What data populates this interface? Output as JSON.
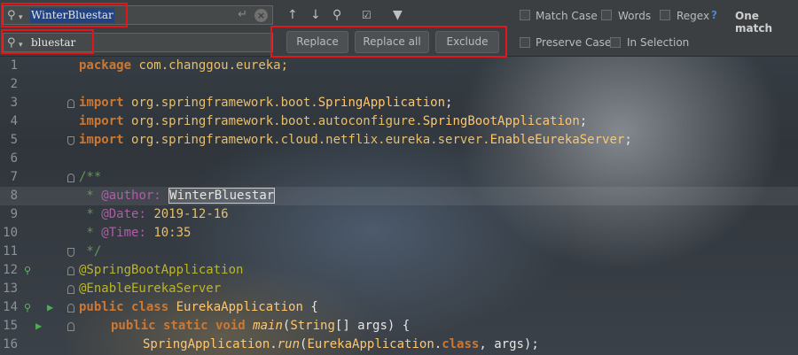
{
  "find": {
    "query": "WinterBluestar",
    "replacement": "bluestar"
  },
  "options": {
    "match_case": "Match Case",
    "words": "Words",
    "regex": "Regex",
    "help": "?",
    "match_count": "One match",
    "preserve_case": "Preserve Case",
    "in_selection": "In Selection"
  },
  "buttons": {
    "replace": "Replace",
    "replace_all": "Replace all",
    "exclude": "Exclude"
  },
  "editor": {
    "line_numbers": [
      "1",
      "2",
      "3",
      "4",
      "5",
      "6",
      "7",
      "8",
      "9",
      "10",
      "11",
      "12",
      "13",
      "14",
      "15",
      "16"
    ],
    "line1": {
      "kw": "package",
      "rest": "com.changgou.eureka;"
    },
    "line3": {
      "kw": "import",
      "pkg": "org.springframework.boot.",
      "cls": "SpringApplication",
      "end": ";"
    },
    "line4": {
      "kw": "import",
      "pkg": "org.springframework.boot.autoconfigure.",
      "cls": "SpringBootApplication",
      "end": ";"
    },
    "line5": {
      "kw": "import",
      "pkg": "org.springframework.cloud.netflix.eureka.server.",
      "cls": "EnableEurekaServer",
      "end": ";"
    },
    "line7": "/**",
    "line8": {
      "prefix": " * ",
      "tag": "@author:",
      "value": "WinterBluestar"
    },
    "line9": {
      "prefix": " * ",
      "tag": "@Date:",
      "value": "2019-12-16"
    },
    "line10": {
      "prefix": " * ",
      "tag": "@Time:",
      "value": "10:35"
    },
    "line11": " */",
    "line12": "@SpringBootApplication",
    "line13": "@EnableEurekaServer",
    "line14": {
      "kw": "public class",
      "cls": "EurekaApplication",
      "end": " {"
    },
    "line15": {
      "kw": "public static void",
      "fn": "main",
      "open": "(",
      "type": "String",
      "args": "[] args) {"
    },
    "line16": {
      "cls1": "SpringApplication",
      "dot": ".",
      "fn": "run",
      "open": "(",
      "cls2": "EurekaApplication",
      "dot2": ".",
      "kw": "class",
      "args": ", args);"
    }
  }
}
